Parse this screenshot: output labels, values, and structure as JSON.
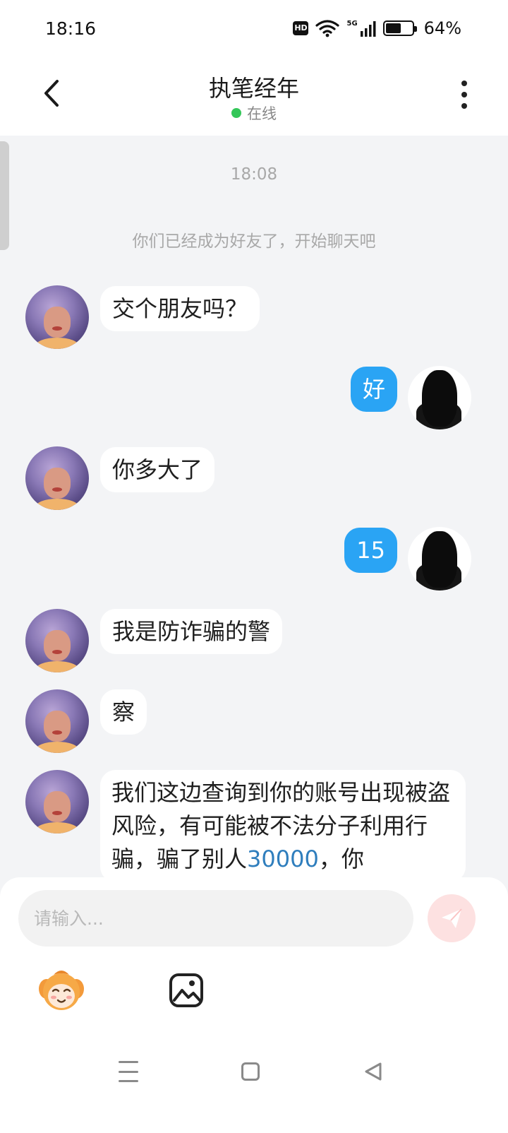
{
  "status_bar": {
    "time": "18:16",
    "hd_label": "HD",
    "network_label": "5G",
    "battery_percent": "64%",
    "battery_level": 0.64
  },
  "header": {
    "contact_name": "执笔经年",
    "presence": "在线"
  },
  "chat": {
    "timestamp": "18:08",
    "system_message": "你们已经成为好友了，开始聊天吧",
    "messages": [
      {
        "side": "in",
        "text": "交个朋友吗？"
      },
      {
        "side": "out",
        "text": "好"
      },
      {
        "side": "in",
        "text": "你多大了"
      },
      {
        "side": "out",
        "text": "15"
      },
      {
        "side": "in",
        "text": "我是防诈骗的警"
      },
      {
        "side": "in",
        "text": "察"
      },
      {
        "side": "in",
        "text_before": "我们这边查询到你的账号出现被盗风险，有可能被不法分子利用行骗，骗了别人",
        "highlight": "30000",
        "text_after": "，你"
      }
    ]
  },
  "composer": {
    "placeholder": "请输入..."
  },
  "colors": {
    "accent_blue": "#2aa4f4",
    "online_green": "#34c759",
    "send_button_bg": "#fde1e1",
    "chat_bg": "#f3f4f6",
    "link_blue": "#2f7ebd"
  },
  "icons": {
    "back": "chevron-left-icon",
    "more": "more-vertical-icon",
    "send": "paper-plane-icon",
    "emoji": "emoji-sticker-icon",
    "image": "image-icon",
    "nav_menu": "menu-icon",
    "nav_home": "home-square-icon",
    "nav_back": "triangle-back-icon"
  }
}
